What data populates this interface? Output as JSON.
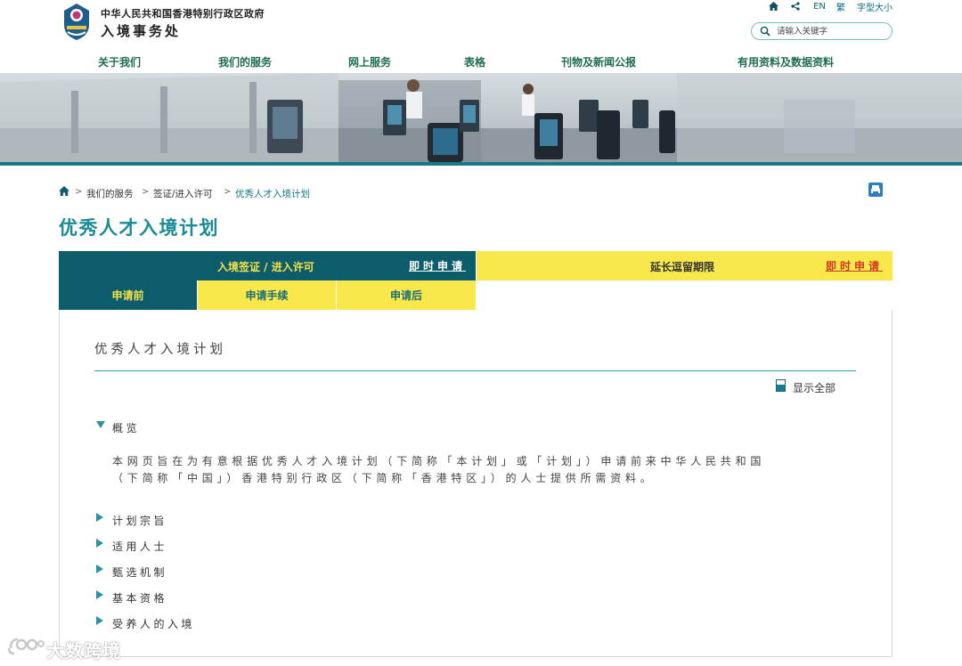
{
  "header": {
    "gov_name": "中华人民共和国香港特别行政区政府",
    "dept_name": "入境事务处",
    "utility": {
      "home_icon": "home-icon",
      "share_icon": "share-icon",
      "lang_en": "EN",
      "lang_trad": "繁",
      "font_size": "字型大小"
    },
    "search": {
      "placeholder": "请输入关键字",
      "icon": "search-icon"
    },
    "nav": [
      "关于我们",
      "我们的服务",
      "网上服务",
      "表格",
      "刊物及新闻公报",
      "有用资料及数据资料"
    ]
  },
  "breadcrumb": [
    "我们的服务",
    "签证/进入许可",
    "优秀人才入境计划"
  ],
  "page_title": "优秀人才入境计划",
  "tabs": {
    "visa": {
      "label": "入境签证 / 进入许可",
      "apply": "即时申请"
    },
    "extend": {
      "label": "延长逗留期限",
      "apply": "即时申请"
    }
  },
  "subtabs": [
    "申请前",
    "申请手续",
    "申请后"
  ],
  "content": {
    "title": "优秀人才入境计划",
    "show_all": "显示全部",
    "sections": [
      {
        "label": "概览",
        "expanded": true,
        "text": [
          "本网页旨在为有意根据优秀人才入境计划（下简称「本计划」或「计划」）申请前来中华人民共和国",
          "（下简称「中国」）香港特别行政区（下简称「香港特区」）的人士提供所需资料。"
        ]
      },
      {
        "label": "计划宗旨",
        "expanded": false
      },
      {
        "label": "适用人士",
        "expanded": false
      },
      {
        "label": "甄选机制",
        "expanded": false
      },
      {
        "label": "基本资格",
        "expanded": false
      },
      {
        "label": "受养人的入境",
        "expanded": false
      }
    ]
  },
  "watermark": {
    "text": "大数跨境"
  },
  "colors": {
    "teal_dark": "#0c5c6b",
    "teal_text": "#1a8a96",
    "yellow": "#f9e84b",
    "nav_green": "#1e6d4f",
    "apply_red": "#d13a1f"
  }
}
